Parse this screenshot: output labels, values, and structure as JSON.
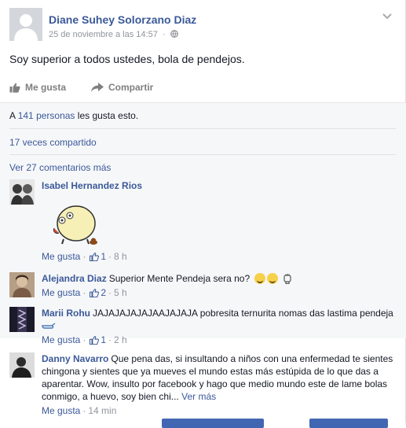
{
  "post": {
    "author": "Diane Suhey Solorzano Diaz",
    "timestamp": "25 de noviembre a las 14:57",
    "separator": "·",
    "text": "Soy superior a todos ustedes, bola de pendejos."
  },
  "actions": {
    "like_label": "Me gusta",
    "share_label": "Compartir"
  },
  "summary": {
    "likes_prefix": "A",
    "likes_count": "141",
    "likes_people": "personas",
    "likes_suffix": "les gusta esto.",
    "shares": "17 veces compartido",
    "more_comments": "Ver 27 comentarios más"
  },
  "comments": [
    {
      "name": "Isabel Hernandez Rios",
      "text": "",
      "like_label": "Me gusta",
      "sep": "·",
      "like_count": "1",
      "time": "8 h"
    },
    {
      "name": "Alejandra Diaz",
      "text": "Superior Mente Pendeja sera no?",
      "like_label": "Me gusta",
      "sep": "·",
      "like_count": "2",
      "time": "5 h"
    },
    {
      "name": "Marii Rohu",
      "text": "JAJAJAJAJAJAAJAJAJA pobresita ternurita nomas das lastima pendeja",
      "like_label": "Me gusta",
      "sep": "·",
      "like_count": "1",
      "time": "2 h"
    },
    {
      "name": "Danny Navarro",
      "text": "Que pena das, si insultando a niños con una enfermedad te sientes chingona y sientes que ya mueves el mundo estas más estúpida de lo que das a aparentar. Wow, insulto por facebook y hago que medio mundo este de lame bolas conmigo, a huevo, soy bien chi...",
      "see_more": "Ver más",
      "like_label": "Me gusta",
      "sep": "·",
      "time": "14 min"
    }
  ],
  "colors": {
    "link": "#3b5998",
    "muted": "#90949c",
    "panel": "#f6f7f9"
  }
}
